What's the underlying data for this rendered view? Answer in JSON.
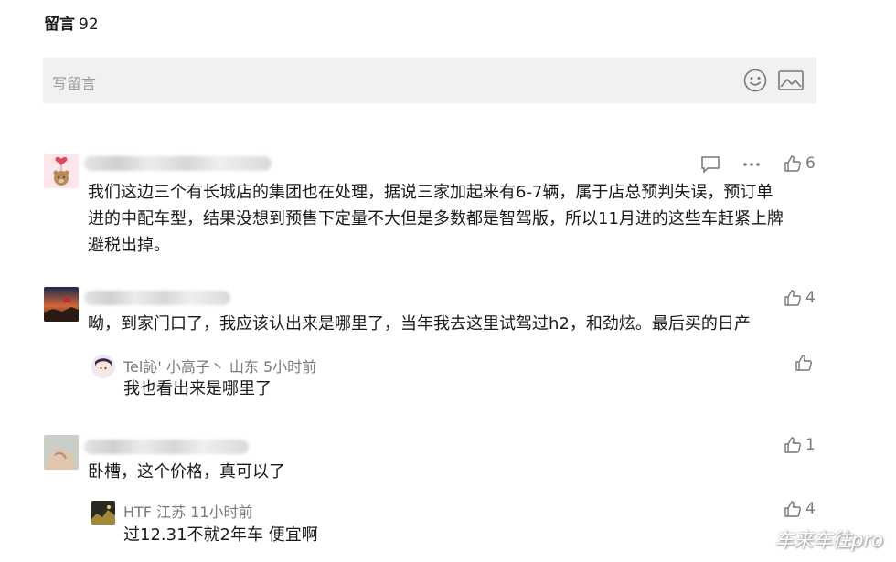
{
  "header": {
    "title": "留言",
    "count": "92"
  },
  "input": {
    "placeholder": "写留言",
    "emoji_icon": "smiley-icon",
    "image_icon": "image-icon"
  },
  "comments": [
    {
      "text_lines": [
        "我们这边三个有长城店的集团也在处理，据说三家加起来有6-7辆，属于店总预判失误，预订单",
        "进的中配车型，结果没想到预售下定量不大但是多数都是智驾版，所以11月进的这些车赶紧上牌",
        "避税出掉。"
      ],
      "likes": "6",
      "icons": [
        "comment-icon",
        "more-icon",
        "thumbs-up-icon"
      ]
    },
    {
      "text_lines": [
        "呦，到家门口了，我应该认出来是哪里了，当年我去这里试驾过h2，和劲炫。最后买的日产"
      ],
      "likes": "4",
      "reply": {
        "meta": "Tel訫' 小高子丶 山东 5小时前",
        "text": "我也看出来是哪里了"
      }
    },
    {
      "text_lines": [
        "卧槽，这个价格，真可以了"
      ],
      "likes": "1",
      "reply": {
        "meta": "HTF 江苏 11小时前",
        "text": "过12.31不就2年车 便宜啊",
        "likes": "4"
      }
    }
  ],
  "watermark": "车来车往pro"
}
